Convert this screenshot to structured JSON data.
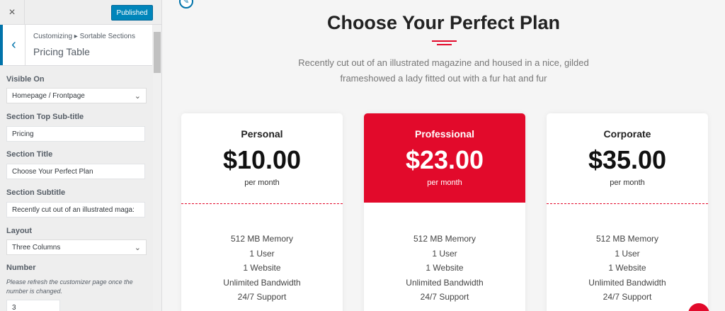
{
  "topbar": {
    "close_icon": "×",
    "publish_label": "Published"
  },
  "panel": {
    "back_icon": "‹",
    "breadcrumb": "Customizing ▸ Sortable Sections",
    "title": "Pricing Table"
  },
  "controls": {
    "visible_on": {
      "label": "Visible On",
      "value": "Homepage / Frontpage"
    },
    "top_subtitle": {
      "label": "Section Top Sub-title",
      "value": "Pricing"
    },
    "section_title": {
      "label": "Section Title",
      "value": "Choose Your Perfect Plan"
    },
    "section_subtitle": {
      "label": "Section Subtitle",
      "value": "Recently cut out of an illustrated maga:"
    },
    "layout": {
      "label": "Layout",
      "value": "Three Columns"
    },
    "number": {
      "label": "Number",
      "description": "Please refresh the customizer page once the number is changed.",
      "value": "3"
    }
  },
  "preview": {
    "title": "Choose Your Perfect Plan",
    "subtitle": "Recently cut out of an illustrated magazine and housed in a nice, gilded frameshowed a lady fitted out with a fur hat and fur",
    "accent_color": "#e20a2b",
    "plans": [
      {
        "name": "Personal",
        "price": "$10.00",
        "period": "per month",
        "featured": false,
        "features": [
          "512 MB Memory",
          "1 User",
          "1 Website",
          "Unlimited Bandwidth",
          "24/7 Support"
        ]
      },
      {
        "name": "Professional",
        "price": "$23.00",
        "period": "per month",
        "featured": true,
        "features": [
          "512 MB Memory",
          "1 User",
          "1 Website",
          "Unlimited Bandwidth",
          "24/7 Support"
        ]
      },
      {
        "name": "Corporate",
        "price": "$35.00",
        "period": "per month",
        "featured": false,
        "features": [
          "512 MB Memory",
          "1 User",
          "1 Website",
          "Unlimited Bandwidth",
          "24/7 Support"
        ]
      }
    ]
  }
}
